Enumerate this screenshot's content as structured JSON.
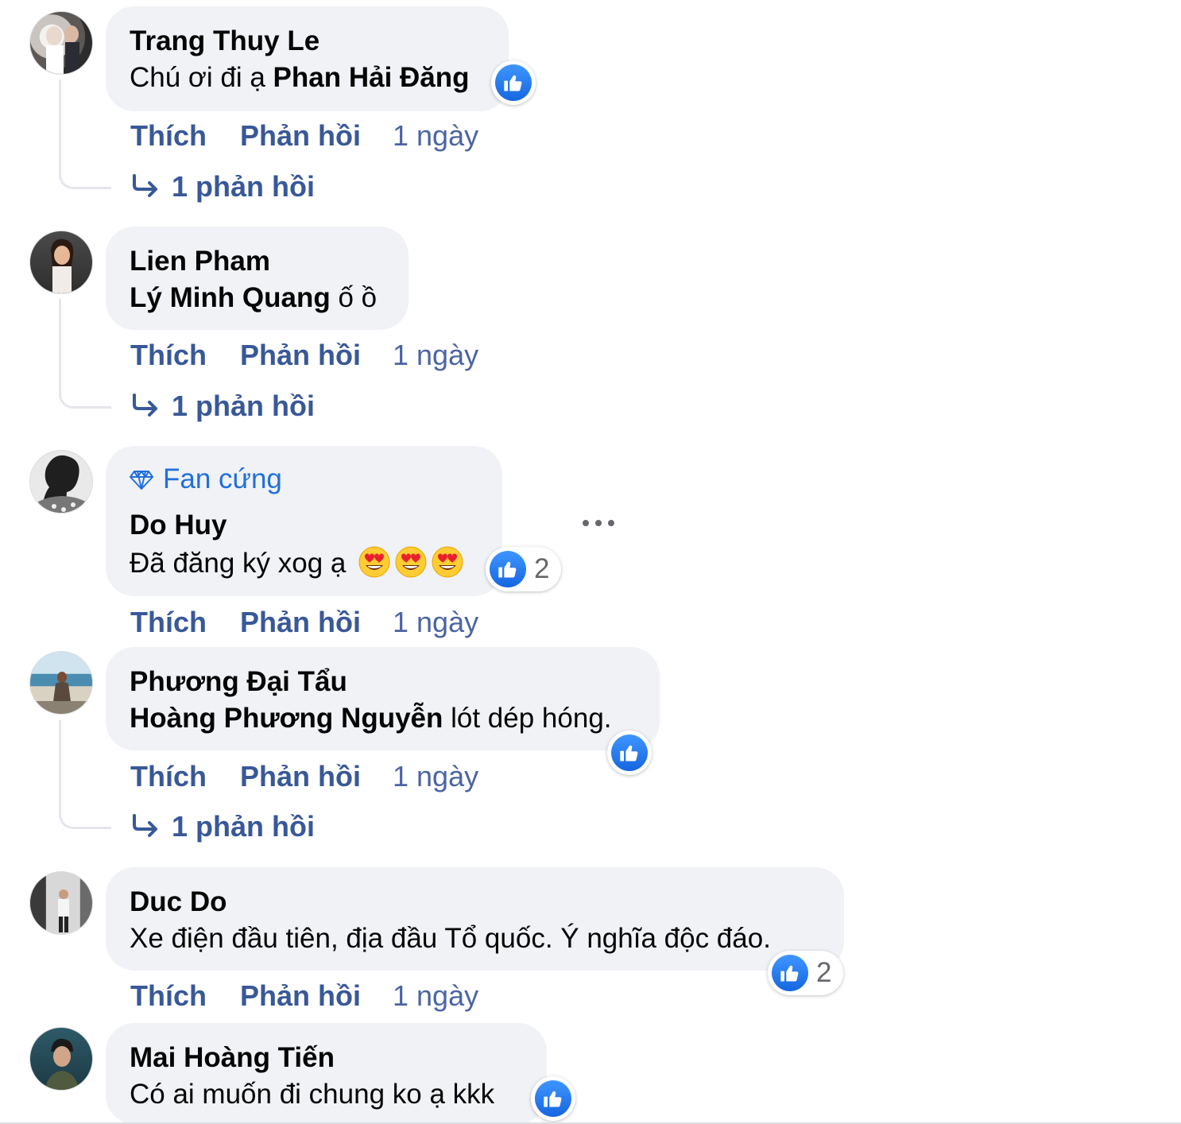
{
  "actions": {
    "like": "Thích",
    "reply": "Phản hồi"
  },
  "colors": {
    "link": "#385898",
    "bubble": "#f0f2f5",
    "like_blue": "#1877f2"
  },
  "comments": [
    {
      "author": "Trang Thuy Le",
      "text": "Chú ơi đi ạ ",
      "mention": "Phan Hải Đăng",
      "time": "1 ngày",
      "reaction": "like-icon",
      "replies": "1 phản hồi"
    },
    {
      "author": "Lien Pham",
      "mention": "Lý Minh Quang",
      "text": " ố ồ",
      "time": "1 ngày",
      "replies": "1 phản hồi"
    },
    {
      "badge": "Fan cứng",
      "author": "Do Huy",
      "text": "Đã đăng ký xog ạ ",
      "emojis": [
        "heart-eyes-emoji",
        "heart-eyes-emoji",
        "heart-eyes-emoji"
      ],
      "time": "1 ngày",
      "reaction": "like-icon",
      "reaction_count": "2"
    },
    {
      "author": "Phương Đại Tẩu",
      "mention": "Hoàng Phương Nguyễn",
      "text": " lót dép hóng.",
      "time": "1 ngày",
      "reaction": "like-icon",
      "replies": "1 phản hồi"
    },
    {
      "author": "Duc Do",
      "text": "Xe điện đầu tiên, địa đầu Tổ quốc. Ý nghĩa độc đáo.",
      "time": "1 ngày",
      "reaction": "like-icon",
      "reaction_count": "2"
    },
    {
      "author": "Mai Hoàng Tiến",
      "text": "Có ai muốn đi chung ko ạ kkk",
      "reaction": "like-icon"
    }
  ]
}
